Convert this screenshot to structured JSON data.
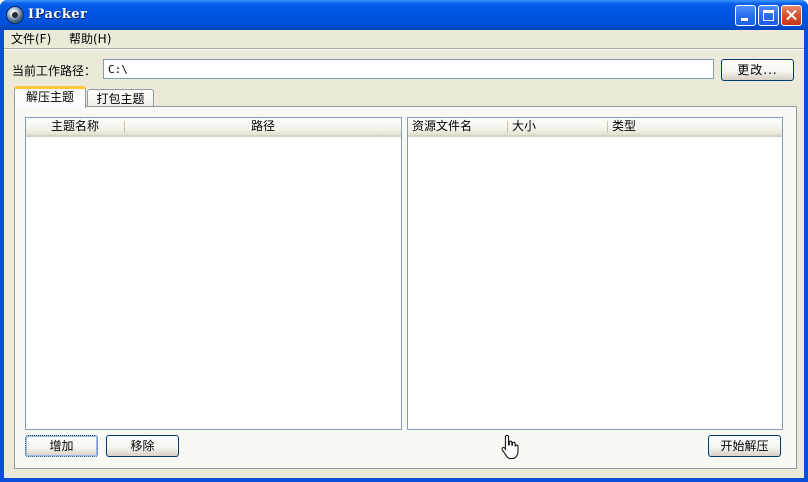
{
  "window": {
    "title": "IPacker"
  },
  "menu": {
    "items": [
      {
        "label": "文件(F)"
      },
      {
        "label": "帮助(H)"
      }
    ]
  },
  "path": {
    "label": "当前工作路径：",
    "value": "C:\\",
    "change_button": "更改..."
  },
  "tabs": [
    {
      "label": "解压主题",
      "active": true
    },
    {
      "label": "打包主题",
      "active": false
    }
  ],
  "theme_list": {
    "columns": [
      "主题名称",
      "路径"
    ],
    "rows": []
  },
  "resource_list": {
    "columns": [
      "资源文件名",
      "大小",
      "类型"
    ],
    "rows": []
  },
  "buttons": {
    "add": "增加",
    "remove": "移除",
    "start_extract": "开始解压"
  },
  "colors": {
    "titlebar": "#0054e3",
    "face": "#ece9d8",
    "tab_highlight": "#ffc73c",
    "border": "#7f9db9"
  }
}
